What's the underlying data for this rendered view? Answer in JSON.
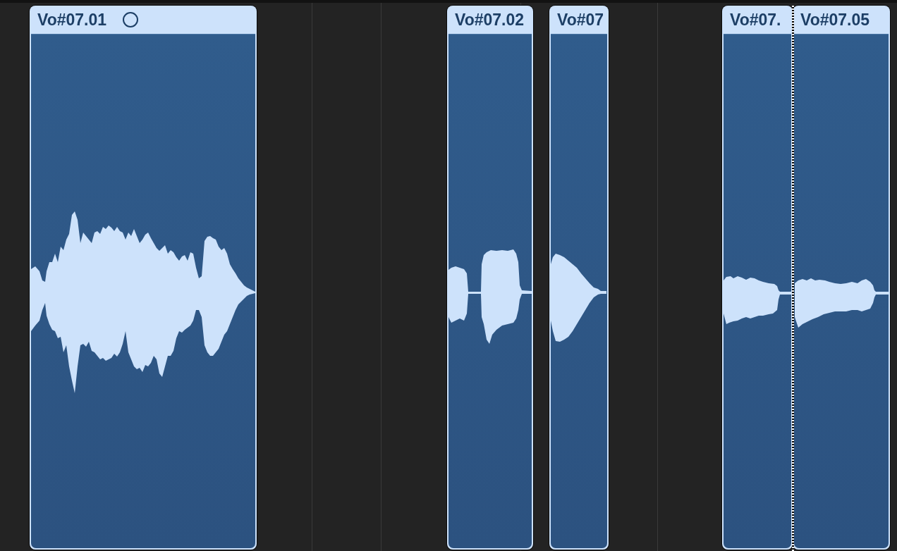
{
  "regions": [
    {
      "name": "Vo#07.01",
      "marked": true
    },
    {
      "name": "Vo#07.02",
      "marked": false
    },
    {
      "name": "Vo#07",
      "marked": false
    },
    {
      "name": "Vo#07.",
      "marked": false
    },
    {
      "name": "Vo#07.05",
      "marked": false
    }
  ]
}
